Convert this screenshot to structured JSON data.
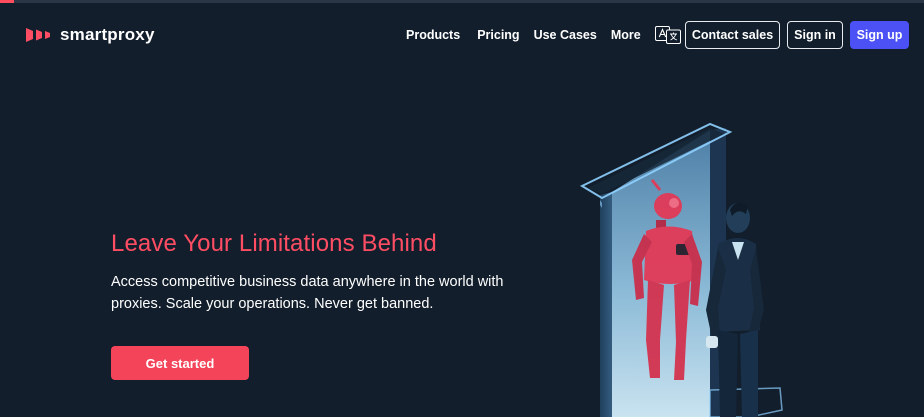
{
  "brand": {
    "name": "smartproxy",
    "accent": "#ff4d63",
    "primary_button": "#4b51f5",
    "background": "#121e2c"
  },
  "nav": {
    "items": [
      {
        "label": "Products"
      },
      {
        "label": "Pricing"
      },
      {
        "label": "Use Cases"
      },
      {
        "label": "More"
      }
    ],
    "language_icon": "translate-icon"
  },
  "header_buttons": {
    "contact_sales": "Contact sales",
    "sign_in": "Sign in",
    "sign_up": "Sign up"
  },
  "hero": {
    "title": "Leave Your Limitations Behind",
    "subtitle": "Access competitive business data anywhere in the world with proxies. Scale your operations. Never get banned.",
    "cta_label": "Get started"
  }
}
